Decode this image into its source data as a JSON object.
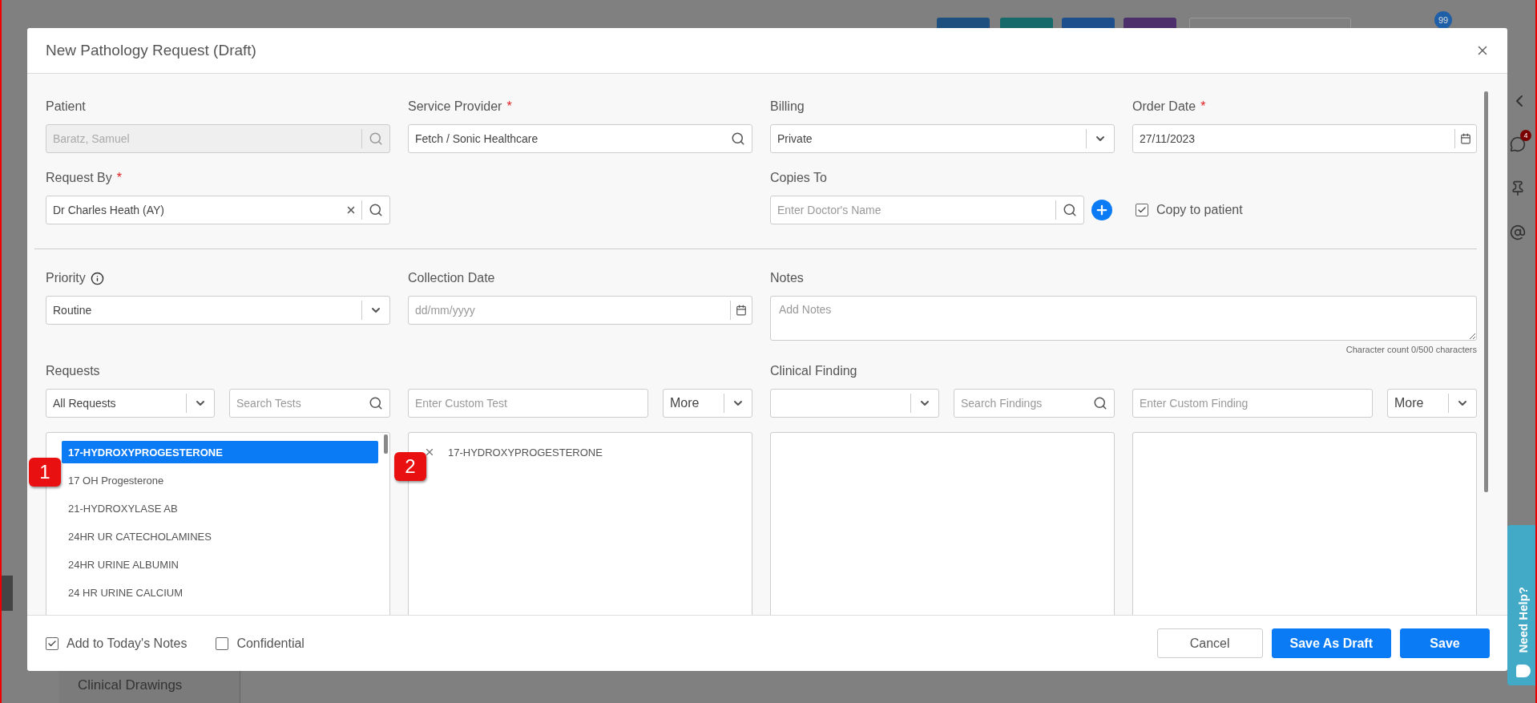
{
  "background": {
    "notification_badge": "99",
    "chat_badge": "4",
    "clinical_drawings": "Clinical Drawings",
    "help_tab": "Need Help?"
  },
  "dialog": {
    "title": "New Pathology Request (Draft)"
  },
  "patient": {
    "label": "Patient",
    "value": "Baratz, Samuel",
    "disabled": true
  },
  "service_provider": {
    "label": "Service Provider",
    "required": "*",
    "value": "Fetch / Sonic Healthcare"
  },
  "billing": {
    "label": "Billing",
    "value": "Private"
  },
  "order_date": {
    "label": "Order Date",
    "required": "*",
    "value": "27/11/2023"
  },
  "request_by": {
    "label": "Request By",
    "required": "*",
    "value": "Dr Charles Heath (AY)"
  },
  "copies_to": {
    "label": "Copies To",
    "placeholder": "Enter Doctor's Name"
  },
  "copy_to_patient": {
    "label": "Copy to patient",
    "checked": true
  },
  "priority": {
    "label": "Priority",
    "value": "Routine"
  },
  "collection_date": {
    "label": "Collection Date",
    "placeholder": "dd/mm/yyyy"
  },
  "notes": {
    "label": "Notes",
    "placeholder": "Add Notes",
    "counter": "Character count 0/500 characters"
  },
  "requests": {
    "label": "Requests",
    "filter": "All Requests",
    "search_placeholder": "Search Tests",
    "custom_placeholder": "Enter Custom Test",
    "more": "More",
    "items": [
      {
        "label": "17-HYDROXYPROGESTERONE",
        "selected": true
      },
      {
        "label": "17 OH Progesterone",
        "selected": false
      },
      {
        "label": "21-HYDROXYLASE AB",
        "selected": false
      },
      {
        "label": "24HR UR CATECHOLAMINES",
        "selected": false
      },
      {
        "label": "24HR URINE ALBUMIN",
        "selected": false
      },
      {
        "label": "24 HR URINE CALCIUM",
        "selected": false
      }
    ],
    "chosen": [
      {
        "label": "17-HYDROXYPROGESTERONE"
      }
    ]
  },
  "clinical_finding": {
    "label": "Clinical Finding",
    "search_placeholder": "Search Findings",
    "custom_placeholder": "Enter Custom Finding",
    "more": "More"
  },
  "annotations": [
    "1",
    "2"
  ],
  "footer": {
    "add_to_notes": {
      "label": "Add to Today's Notes",
      "checked": true
    },
    "confidential": {
      "label": "Confidential",
      "checked": false
    },
    "buttons": [
      {
        "label": "Cancel",
        "kind": "secondary"
      },
      {
        "label": "Save As Draft",
        "kind": "primary"
      },
      {
        "label": "Save",
        "kind": "primary"
      }
    ]
  }
}
